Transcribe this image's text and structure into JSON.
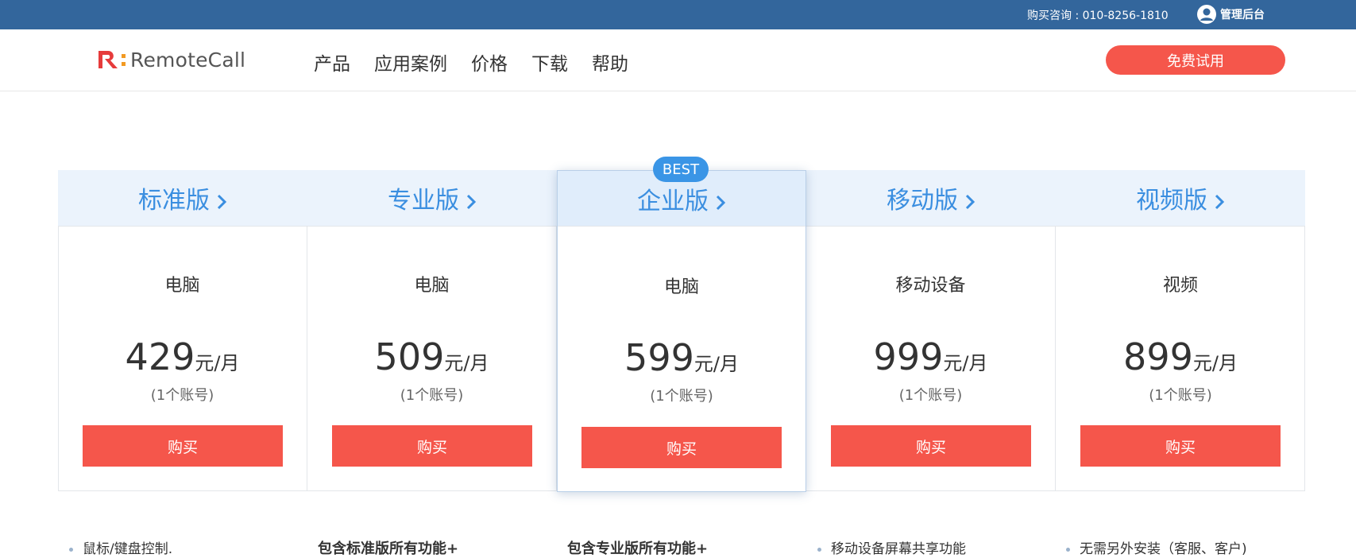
{
  "topbar": {
    "phone": "购买咨询 : 010-8256-1810",
    "admin_label": "管理后台",
    "admin_icon": "user-circle-icon",
    "background": "#33669c"
  },
  "header": {
    "logo_text": "RemoteCall",
    "nav": [
      "产品",
      "应用案例",
      "价格",
      "下载",
      "帮助"
    ],
    "trial_button": "免费试用"
  },
  "badge": "BEST",
  "plans": [
    {
      "name": "标准版",
      "device": "电脑",
      "price": "429",
      "unit": "元/月",
      "account": "(1个账号)",
      "buy": "购买"
    },
    {
      "name": "专业版",
      "device": "电脑",
      "price": "509",
      "unit": "元/月",
      "account": "(1个账号)",
      "buy": "购买"
    },
    {
      "name": "企业版",
      "device": "电脑",
      "price": "599",
      "unit": "元/月",
      "account": "(1个账号)",
      "buy": "购买"
    },
    {
      "name": "移动版",
      "device": "移动设备",
      "price": "999",
      "unit": "元/月",
      "account": "(1个账号)",
      "buy": "购买"
    },
    {
      "name": "视频版",
      "device": "视频",
      "price": "899",
      "unit": "元/月",
      "account": "(1个账号)",
      "buy": "购买"
    }
  ],
  "features": [
    "鼠标/键盘控制.",
    "包含标准版所有功能+",
    "包含专业版所有功能+",
    "移动设备屏幕共享功能",
    "无需另外安装（客服、客户)"
  ],
  "colors": {
    "accent_red": "#f5564b",
    "accent_blue": "#3a8ee0",
    "tab_bg": "#ebf3fc"
  }
}
